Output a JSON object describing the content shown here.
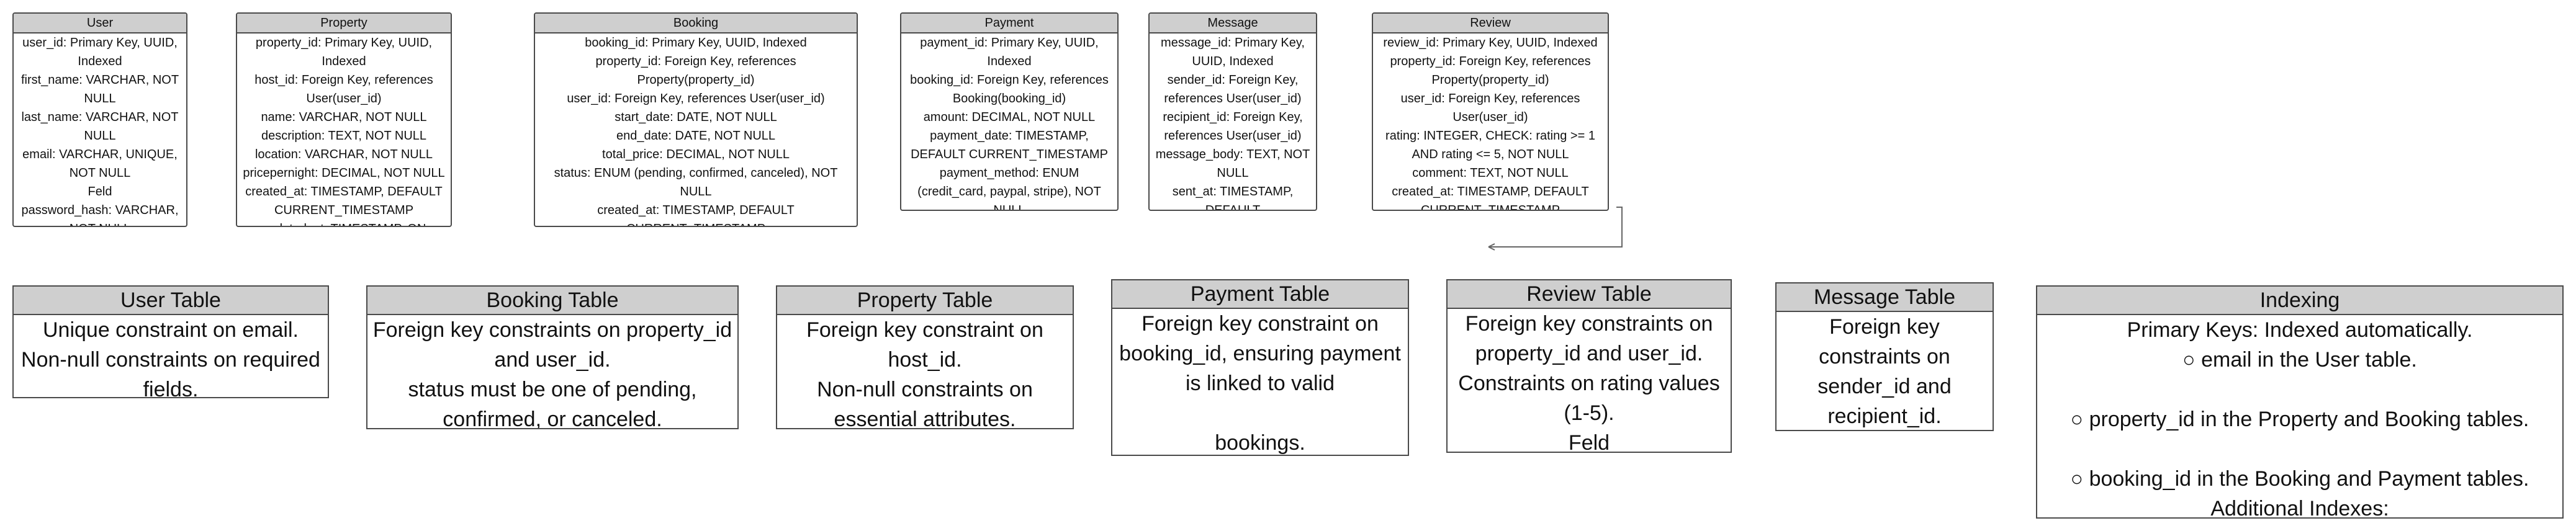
{
  "entities": [
    {
      "name": "User",
      "fields": [
        "user_id: Primary Key, UUID, Indexed",
        "first_name: VARCHAR, NOT NULL",
        "last_name: VARCHAR, NOT NULL",
        "email: VARCHAR, UNIQUE, NOT NULL",
        "Feld",
        "password_hash: VARCHAR, NOT NULL"
      ]
    },
    {
      "name": "Property",
      "fields": [
        "property_id: Primary Key, UUID, Indexed",
        "host_id: Foreign Key, references User(user_id)",
        "name: VARCHAR, NOT NULL",
        "description: TEXT, NOT NULL",
        "location: VARCHAR, NOT NULL",
        "pricepernight: DECIMAL, NOT NULL",
        "created_at: TIMESTAMP, DEFAULT CURRENT_TIMESTAMP",
        "updated_at: TIMESTAMP, ON UPDATE CURRENT_TIMESTAMP"
      ]
    },
    {
      "name": "Booking",
      "fields": [
        "booking_id: Primary Key, UUID, Indexed",
        "property_id: Foreign Key, references Property(property_id)",
        "user_id: Foreign Key, references User(user_id)",
        "start_date: DATE, NOT NULL",
        "end_date: DATE, NOT NULL",
        "total_price: DECIMAL, NOT NULL",
        "status: ENUM (pending, confirmed, canceled), NOT NULL",
        "created_at: TIMESTAMP, DEFAULT CURRENT_TIMESTAMP"
      ]
    },
    {
      "name": "Payment",
      "fields": [
        "payment_id: Primary Key, UUID, Indexed",
        "booking_id: Foreign Key, references Booking(booking_id)",
        "amount: DECIMAL, NOT NULL",
        "payment_date: TIMESTAMP, DEFAULT CURRENT_TIMESTAMP",
        "payment_method: ENUM (credit_card, paypal, stripe), NOT NULL"
      ]
    },
    {
      "name": "Message",
      "fields": [
        "message_id: Primary Key, UUID, Indexed",
        "sender_id: Foreign Key, references User(user_id)",
        "recipient_id: Foreign Key, references User(user_id)",
        "message_body: TEXT, NOT NULL",
        "sent_at: TIMESTAMP, DEFAULT CURRENT_TIMESTAMP"
      ]
    },
    {
      "name": "Review",
      "fields": [
        "review_id: Primary Key, UUID, Indexed",
        "property_id: Foreign Key, references Property(property_id)",
        "user_id: Foreign Key, references User(user_id)",
        "rating: INTEGER, CHECK: rating >= 1 AND rating <= 5, NOT NULL",
        "comment: TEXT, NOT NULL",
        "created_at: TIMESTAMP, DEFAULT CURRENT_TIMESTAMP"
      ]
    }
  ],
  "notes": [
    {
      "title": "User Table",
      "lines": [
        "Unique constraint on email.",
        "Non-null constraints on required fields."
      ]
    },
    {
      "title": "Booking Table",
      "lines": [
        "Foreign key constraints on property_id and user_id.",
        "status must be one of pending, confirmed, or canceled."
      ]
    },
    {
      "title": "Property Table",
      "lines": [
        "Foreign key constraint on host_id.",
        "Non-null constraints on essential attributes."
      ]
    },
    {
      "title": "Payment Table",
      "lines": [
        "Foreign key constraint on booking_id, ensuring payment is linked to valid",
        "",
        "bookings."
      ]
    },
    {
      "title": "Review Table",
      "lines": [
        "Foreign key constraints on property_id and user_id.",
        "Constraints on rating values (1-5).",
        "Feld"
      ]
    },
    {
      "title": "Message Table",
      "lines": [
        "Foreign key constraints on sender_id and recipient_id."
      ]
    },
    {
      "title": "Indexing",
      "lines": [
        "Primary Keys: Indexed automatically.",
        "○ email in the User table.",
        "",
        "○ property_id in the Property and Booking tables.",
        "",
        "○ booking_id in the Booking and Payment tables.",
        "Additional Indexes:"
      ]
    }
  ]
}
